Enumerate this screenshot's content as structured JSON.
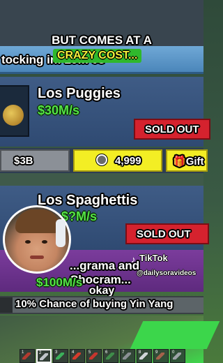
{
  "captions": {
    "top_line": "BUT COMES AT A",
    "highlight": "CRAZY COST...",
    "bottom": "okay"
  },
  "header": {
    "stock_text": "tocking in: 29m 0s"
  },
  "cards": [
    {
      "name": "Los Puggies",
      "price": "$30M/s",
      "status": "SOLD OUT"
    },
    {
      "name": "Los Spaghettis",
      "price": "$?M/s",
      "status": "SOLD OUT"
    },
    {
      "name": "...grama and Chocram...",
      "price": "$100M/s"
    }
  ],
  "buy_row": {
    "cash": "$3B",
    "robux": "4,999",
    "gift": "Gift"
  },
  "tiktok": {
    "brand": "TikTok",
    "user": "@dailysoravideos"
  },
  "chance_bar": {
    "text": "10% Chance of buying Yin Yang"
  },
  "hotbar": {
    "slots": [
      {
        "num": "1",
        "icon": "sword-icon",
        "color": "#b23a2f"
      },
      {
        "num": "2",
        "icon": "bat-icon",
        "color": "#bfc4c9"
      },
      {
        "num": "3",
        "icon": "sword-icon",
        "color": "#3bb05a"
      },
      {
        "num": "4",
        "icon": "sword-icon",
        "color": "#d43b2c"
      },
      {
        "num": "5",
        "icon": "gun-icon",
        "color": "#c6362e"
      },
      {
        "num": "6",
        "icon": "hammer-icon",
        "color": "#3e8c4a"
      },
      {
        "num": "7",
        "icon": "block-icon",
        "color": "#8a8f94"
      },
      {
        "num": "8",
        "icon": "pickaxe-icon",
        "color": "#cfd4d8"
      },
      {
        "num": "9",
        "icon": "bow-icon",
        "color": "#a4624b"
      },
      {
        "num": "0",
        "icon": "tool-icon",
        "color": "#9ea3a8"
      }
    ]
  },
  "colors": {
    "sold_out": "#d5222e",
    "price_green": "#54e346",
    "robux_button": "#f3ee24",
    "caption_highlight_bg": "#2fb82c",
    "caption_highlight_text": "#f7f43a"
  }
}
